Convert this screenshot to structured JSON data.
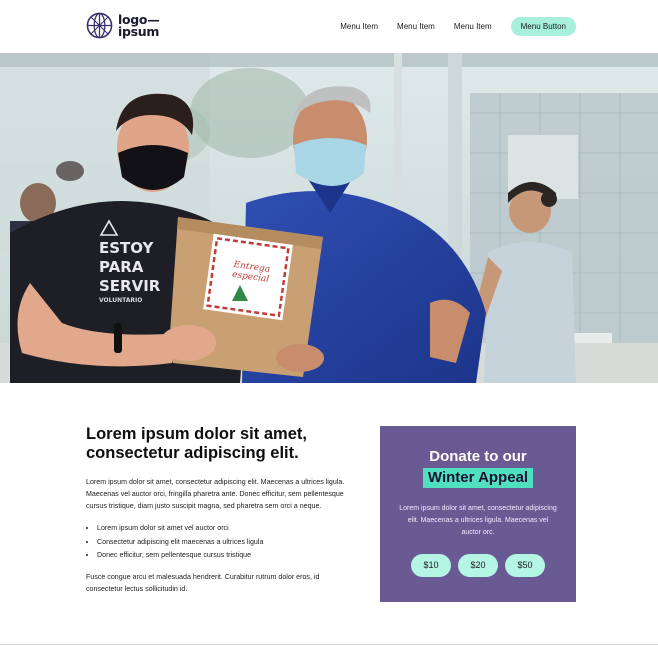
{
  "logo": {
    "line1": "logo—",
    "line2": "ipsum",
    "mark": "sphere-grid-icon"
  },
  "nav": {
    "items": [
      "Menu Item",
      "Menu Item",
      "Menu Item"
    ],
    "button": "Menu Button"
  },
  "hero": {
    "shirt_lines": [
      "ESTOY",
      "PARA",
      "SERVIR",
      "VOLUNTARIO"
    ],
    "bag_lines": [
      "Entrega",
      "especial"
    ]
  },
  "article": {
    "title": "Lorem ipsum dolor sit amet, consectetur adipiscing elit.",
    "intro": "Lorem ipsum dolor sit amet, consectetur adipiscing elit. Maecenas a ultrices ligula. Maecenas vel auctor orci, fringilla pharetra ante. Donec efficitur, sem pellentesque cursus tristique, diam justo suscipit magna, sed pharetra sem orci a neque.",
    "bullets": [
      "Lorem ipsum dolor sit amet vel auctor orci",
      "Consectetur adipiscing elit maecenas a ultrices ligula",
      "Donec efficitur, sem pellentesque cursus tristique"
    ],
    "closing": "Fusce congue arcu et malesuada hendrerit. Curabitur rutrum dolor eros, id consectetur lectus sollicitudin id."
  },
  "donate": {
    "title_line1": "Donate to our",
    "title_highlight": "Winter Appeal",
    "body": "Lorem ipsum dolor sit amet, consectetur adipiscing elit. Maecenas a ultrices ligula. Maecenas vel auctor orc.",
    "amounts": [
      "$10",
      "$20",
      "$50"
    ]
  },
  "colors": {
    "accent": "#a8f0dc",
    "card": "#6a5a94",
    "highlight": "#4fe0c0"
  }
}
